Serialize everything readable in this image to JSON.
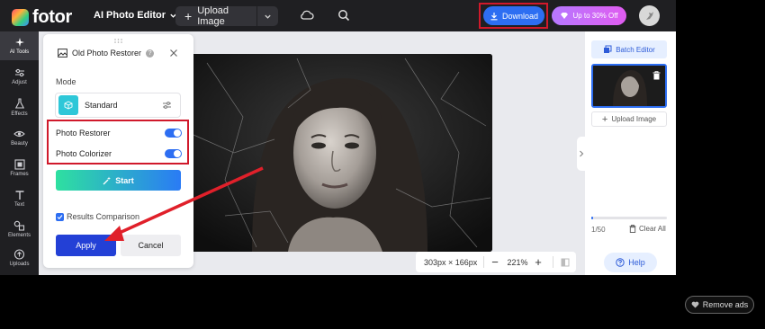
{
  "header": {
    "logo_text": "fotor",
    "menu_label": "AI Photo Editor",
    "upload_label": "Upload Image",
    "download_label": "Download",
    "promo_label": "Up to 30% Off"
  },
  "sidebar": {
    "items": [
      {
        "label": "AI Tools",
        "icon": "sparkle-icon"
      },
      {
        "label": "Adjust",
        "icon": "sliders-icon"
      },
      {
        "label": "Effects",
        "icon": "flask-icon"
      },
      {
        "label": "Beauty",
        "icon": "eye-icon"
      },
      {
        "label": "Frames",
        "icon": "frame-icon"
      },
      {
        "label": "Text",
        "icon": "text-icon"
      },
      {
        "label": "Elements",
        "icon": "shapes-icon"
      },
      {
        "label": "Uploads",
        "icon": "cloud-upload-icon"
      }
    ]
  },
  "panel": {
    "title": "Old Photo Restorer",
    "mode_label": "Mode",
    "mode_value": "Standard",
    "toggles": [
      {
        "label": "Photo Restorer",
        "on": true
      },
      {
        "label": "Photo Colorizer",
        "on": true
      }
    ],
    "start_label": "Start",
    "compare_label": "Results Comparison",
    "apply_label": "Apply",
    "cancel_label": "Cancel"
  },
  "canvas": {
    "dimensions": "303px × 166px",
    "zoom": "221%"
  },
  "right_panel": {
    "batch_label": "Batch Editor",
    "upload_label": "Upload Image",
    "count": "1/50",
    "progress": 0.02,
    "clear_label": "Clear All",
    "help_label": "Help"
  },
  "footer": {
    "remove_ads_label": "Remove ads"
  },
  "colors": {
    "accent": "#2d6ef2",
    "highlight": "#d0192b",
    "apply": "#2340d6"
  }
}
